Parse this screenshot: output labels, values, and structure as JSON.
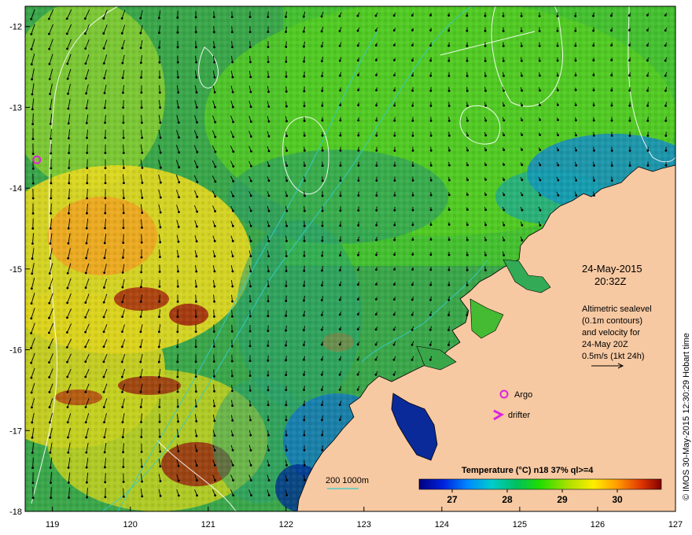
{
  "map": {
    "lon_range": [
      118.65,
      127
    ],
    "lat_range": [
      -18,
      -11.75
    ],
    "x_ticks": [
      119,
      120,
      121,
      122,
      123,
      124,
      125,
      126,
      127
    ],
    "y_ticks": [
      -12,
      -13,
      -14,
      -15,
      -16,
      -17,
      -18
    ],
    "x_tick_labels": [
      "119",
      "120",
      "121",
      "122",
      "123",
      "124",
      "125",
      "126",
      "127"
    ],
    "y_tick_labels": [
      "-12",
      "-13",
      "-14",
      "-15",
      "-16",
      "-17",
      "-18"
    ],
    "land_color": "#f7c9a2",
    "coast_color": "#000000",
    "contour_color": "#ffffff",
    "isobath_color": "#33cccc"
  },
  "annotation": {
    "date": "24-May-2015",
    "time": "20:32Z",
    "altimetry_lines": [
      "Altimetric sealevel",
      "(0.1m contours)",
      "and velocity for",
      "24-May 20Z",
      "0.5m/s (1kt 24h)"
    ]
  },
  "legend": {
    "argo_label": "Argo",
    "drifter_label": "drifter",
    "marker_color": "#dd22dd",
    "isobath_label": "200  1000m"
  },
  "colorbar": {
    "title": "Temperature (°C) n18 37% ql>=4",
    "ticks": [
      "27",
      "28",
      "29",
      "30"
    ],
    "min": 26.4,
    "max": 30.8,
    "tick_values": [
      27,
      28,
      29,
      30
    ],
    "stops": [
      "#000080",
      "#0022dd",
      "#0088ff",
      "#00cccc",
      "#00c060",
      "#22dd00",
      "#b0e000",
      "#ffee00",
      "#ff9900",
      "#dd3300",
      "#800000"
    ]
  },
  "credit": "© IMOS 30-May-2015 12:30:29 Hobart time",
  "argo_float": {
    "lon": 118.8,
    "lat": -13.65
  }
}
